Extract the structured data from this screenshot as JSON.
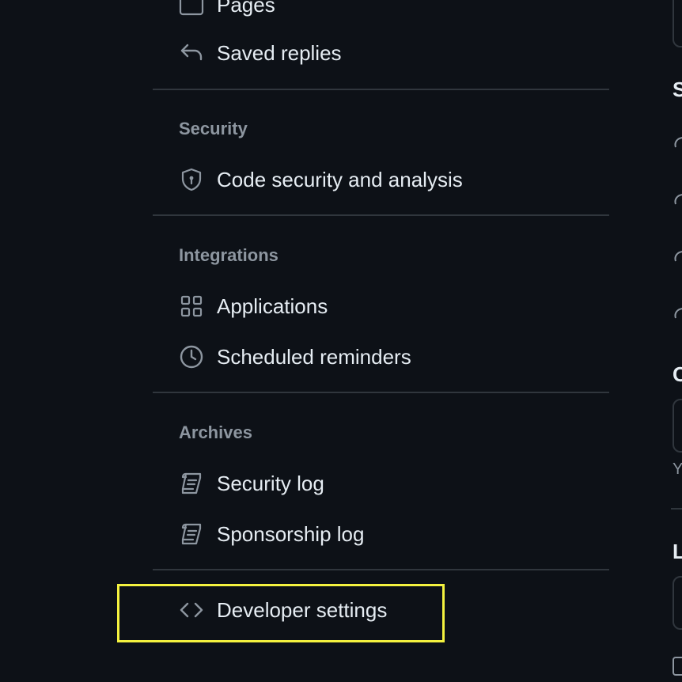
{
  "sidebar": {
    "pages_label": "Pages",
    "saved_replies_label": "Saved replies",
    "security": {
      "title": "Security",
      "items": [
        "Code security and analysis"
      ]
    },
    "integrations": {
      "title": "Integrations",
      "items": [
        "Applications",
        "Scheduled reminders"
      ]
    },
    "archives": {
      "title": "Archives",
      "items": [
        "Security log",
        "Sponsorship log"
      ]
    },
    "developer_settings_label": "Developer settings"
  },
  "right_panel_partial": {
    "heading_1": "S",
    "heading_2": "C",
    "text_1": "Y",
    "heading_3": "L"
  },
  "colors": {
    "background": "#0d1117",
    "text": "#e6edf3",
    "muted": "#8d96a0",
    "divider": "#30363d",
    "highlight": "#f4f23f"
  },
  "icons": {
    "pages": "browser-icon",
    "saved_replies": "reply-icon",
    "code_security": "shield-lock-icon",
    "applications": "apps-icon",
    "scheduled_reminders": "clock-icon",
    "security_log": "log-icon",
    "sponsorship_log": "log-icon",
    "developer_settings": "code-icon"
  }
}
